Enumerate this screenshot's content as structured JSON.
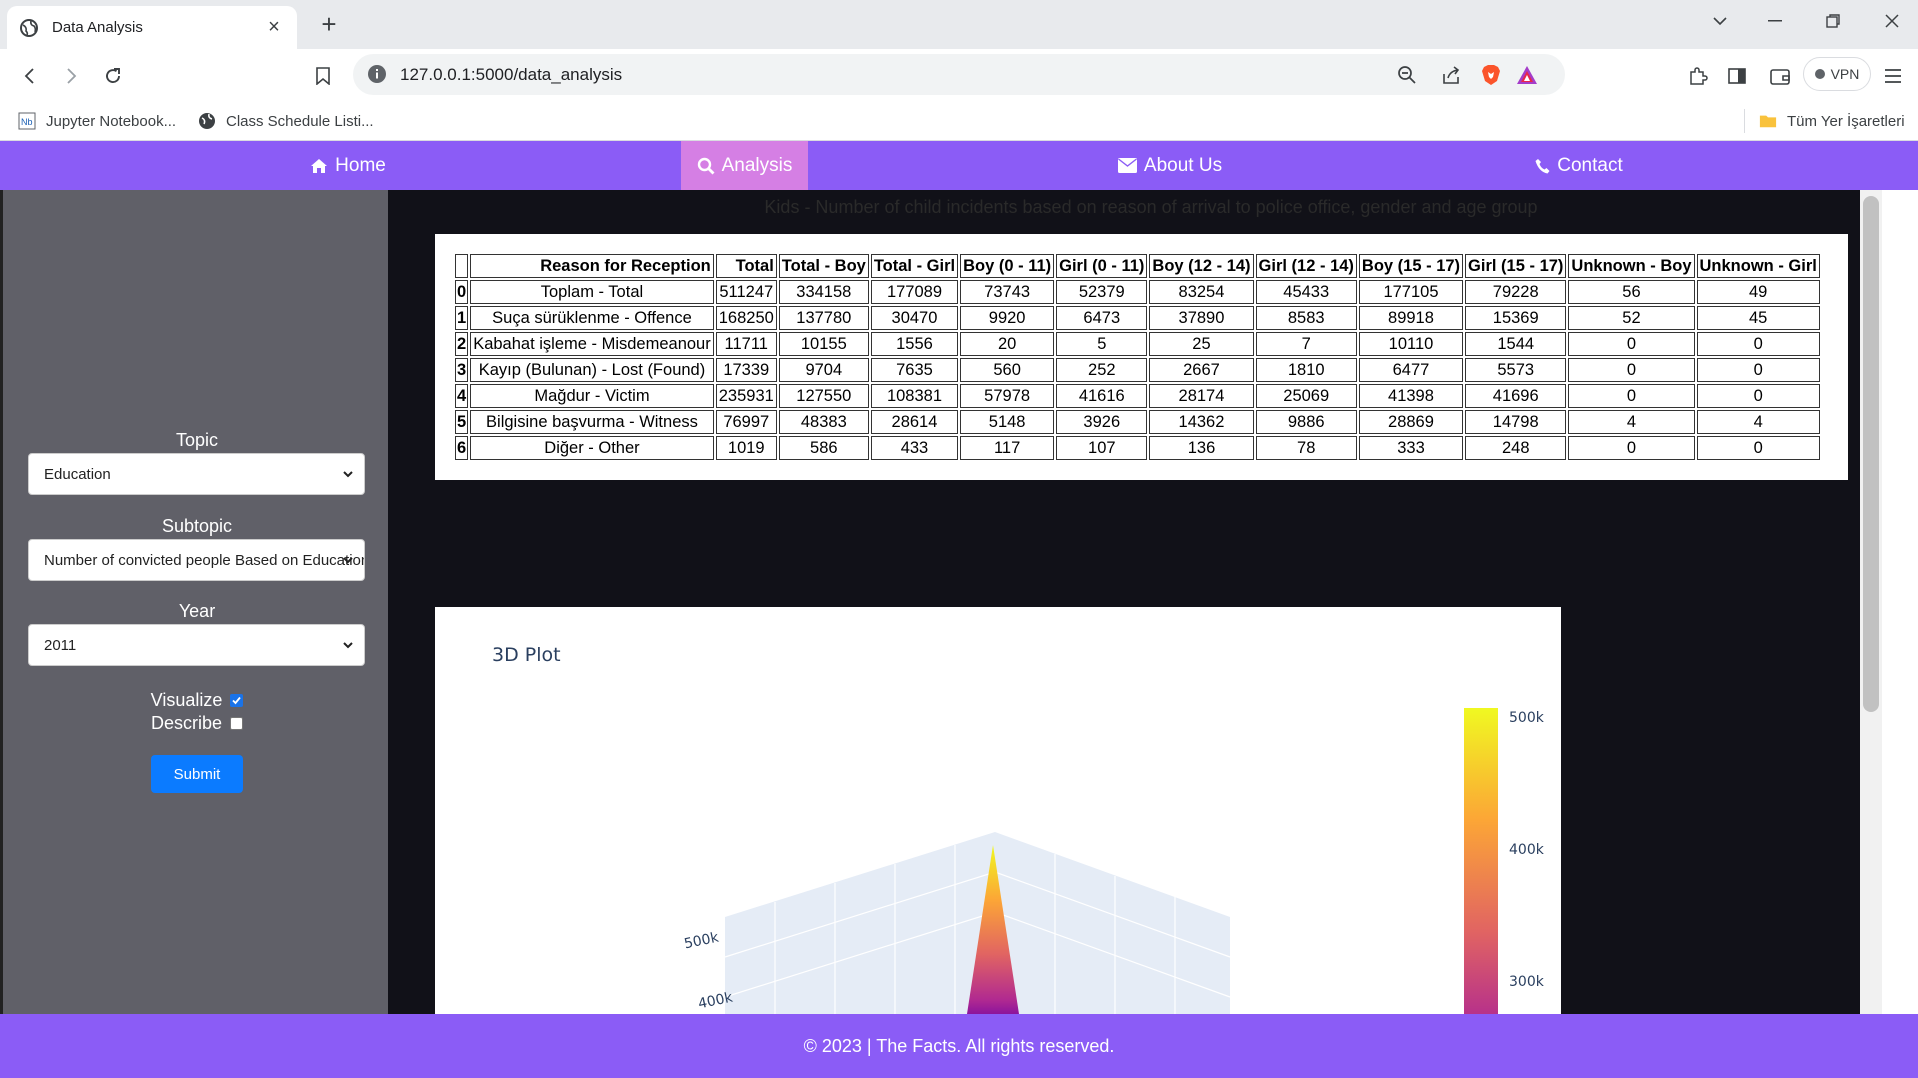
{
  "browser": {
    "tab_title": "Data Analysis",
    "url": "127.0.0.1:5000/data_analysis",
    "vpn_label": "VPN",
    "bookmarks": [
      {
        "label": "Jupyter Notebook...",
        "icon": "jupyter-icon"
      },
      {
        "label": "Class Schedule Listi...",
        "icon": "globe-icon"
      }
    ],
    "all_bookmarks_label": "Tüm Yer İşaretleri"
  },
  "nav": {
    "home": "Home",
    "analysis": "Analysis",
    "about": "About Us",
    "contact": "Contact"
  },
  "sidebar": {
    "topic_label": "Topic",
    "topic_value": "Education",
    "subtopic_label": "Subtopic",
    "subtopic_value": "Number of convicted people Based on Education",
    "year_label": "Year",
    "year_value": "2011",
    "visualize_label": "Visualize",
    "visualize_checked": true,
    "describe_label": "Describe",
    "describe_checked": false,
    "submit_label": "Submit"
  },
  "main": {
    "caption": "Kids - Number of child incidents based on reason of arrival to police office, gender and age group",
    "table": {
      "headers": [
        "",
        "Reason for Reception",
        "Total",
        "Total - Boy",
        "Total - Girl",
        "Boy (0 - 11)",
        "Girl (0 - 11)",
        "Boy (12 - 14)",
        "Girl (12 - 14)",
        "Boy (15 - 17)",
        "Girl (15 - 17)",
        "Unknown - Boy",
        "Unknown - Girl"
      ],
      "rows": [
        [
          "0",
          "Toplam - Total",
          "511247",
          "334158",
          "177089",
          "73743",
          "52379",
          "83254",
          "45433",
          "177105",
          "79228",
          "56",
          "49"
        ],
        [
          "1",
          "Suça sürüklenme - Offence",
          "168250",
          "137780",
          "30470",
          "9920",
          "6473",
          "37890",
          "8583",
          "89918",
          "15369",
          "52",
          "45"
        ],
        [
          "2",
          "Kabahat işleme - Misdemeanour",
          "11711",
          "10155",
          "1556",
          "20",
          "5",
          "25",
          "7",
          "10110",
          "1544",
          "0",
          "0"
        ],
        [
          "3",
          "Kayıp (Bulunan) - Lost (Found)",
          "17339",
          "9704",
          "7635",
          "560",
          "252",
          "2667",
          "1810",
          "6477",
          "5573",
          "0",
          "0"
        ],
        [
          "4",
          "Mağdur - Victim",
          "235931",
          "127550",
          "108381",
          "57978",
          "41616",
          "28174",
          "25069",
          "41398",
          "41696",
          "0",
          "0"
        ],
        [
          "5",
          "Bilgisine başvurma - Witness",
          "76997",
          "48383",
          "28614",
          "5148",
          "3926",
          "14362",
          "9886",
          "28869",
          "14798",
          "4",
          "4"
        ],
        [
          "6",
          "Diğer - Other",
          "1019",
          "586",
          "433",
          "117",
          "107",
          "136",
          "78",
          "333",
          "248",
          "0",
          "0"
        ]
      ]
    },
    "plot": {
      "title": "3D Plot",
      "colorbar_ticks": [
        "500k",
        "400k",
        "300k"
      ],
      "axis_ticks": [
        "500k",
        "400k"
      ],
      "colorscale": [
        "#f0f921",
        "#fca636",
        "#e16462",
        "#b12a90",
        "#6a00a8",
        "#0d0887"
      ]
    }
  },
  "footer": {
    "text": "© 2023 | The Facts. All rights reserved."
  }
}
